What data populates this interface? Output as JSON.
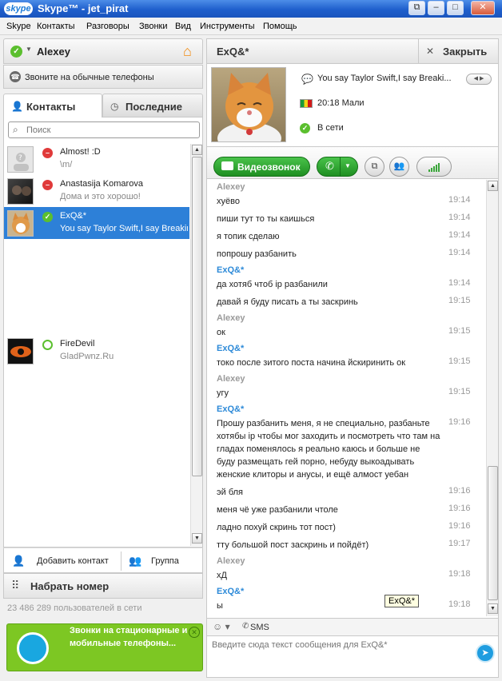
{
  "window": {
    "logo": "skype",
    "title": "Skype™ - jet_pirat",
    "buttons": [
      "⧉",
      "–",
      "□",
      "✕"
    ]
  },
  "menu": [
    "Skype",
    "Контакты",
    "Разговоры",
    "Звонки",
    "Вид",
    "Инструменты",
    "Помощь"
  ],
  "profile": {
    "name": "Alexey",
    "call_phones": "Звоните на обычные телефоны",
    "status_icon": "online-check-icon",
    "home_icon": "home-icon"
  },
  "tabs": {
    "contacts": "Контакты",
    "recent": "Последние"
  },
  "search": {
    "placeholder": "Поиск"
  },
  "contacts": [
    {
      "name": "Almost! :D",
      "mood": "\\m/",
      "status": "offline"
    },
    {
      "name": "Anastasija Komarova",
      "mood": "Дома и это хорошо!",
      "status": "offline"
    },
    {
      "name": "ExQ&*",
      "mood": "You say Taylor Swift,I say Breaking Benjamin.",
      "status": "online"
    },
    {
      "name": "FireDevil",
      "mood": "GladPwnz.Ru",
      "status": "away"
    }
  ],
  "left_bottom": {
    "add_contact": "Добавить контакт",
    "group": "Группа",
    "dial": "Набрать номер",
    "users_online": "23 486 289 пользователей в сети",
    "promo": "Звонки на стационарные и мобильные телефоны..."
  },
  "chat": {
    "name": "ExQ&*",
    "close": "Закрыть",
    "mood": "You say Taylor Swift,I say Breaki...",
    "local_time": "20:18 Мали",
    "status": "В сети",
    "video_call": "Видеозвонок",
    "tooltip": "ExQ&*",
    "sms": "SMS",
    "input_placeholder": "Введите сюда текст сообщения для ExQ&*"
  },
  "messages": [
    {
      "type": "sender",
      "who": "me",
      "text": "Alexey"
    },
    {
      "type": "msg",
      "text": "хуёво",
      "time": "19:14"
    },
    {
      "type": "msg",
      "text": "пиши тут то ты каишься",
      "time": "19:14"
    },
    {
      "type": "msg",
      "text": "я топик сделаю",
      "time": "19:14"
    },
    {
      "type": "msg",
      "text": "попрошу разбанить",
      "time": "19:14"
    },
    {
      "type": "sender",
      "who": "them",
      "text": "ExQ&*"
    },
    {
      "type": "msg",
      "text": "да хотяб чтоб ip разбанили",
      "time": "19:14"
    },
    {
      "type": "msg",
      "text": "давай я буду писать а ты заскринь",
      "time": "19:15"
    },
    {
      "type": "sender",
      "who": "me",
      "text": "Alexey"
    },
    {
      "type": "msg",
      "text": "ок",
      "time": "19:15"
    },
    {
      "type": "sender",
      "who": "them",
      "text": "ExQ&*"
    },
    {
      "type": "msg",
      "text": "токо после зитого поста начина йскиринить ок",
      "time": "19:15"
    },
    {
      "type": "sender",
      "who": "me",
      "text": "Alexey"
    },
    {
      "type": "msg",
      "text": "угу",
      "time": "19:15"
    },
    {
      "type": "sender",
      "who": "them",
      "text": "ExQ&*"
    },
    {
      "type": "msg",
      "text": "Прошу разбанить меня, я не специально, разбаньте хотябы ip чтобы мог заходить и посмотреть что там на гладах поменялось я реально каюсь и больше не буду размещать гей порно, небуду выкоадывать женские клиторы и анусы, и ещё алмост уебан",
      "time": "19:16",
      "lines": 5
    },
    {
      "type": "msg",
      "text": "эй бля",
      "time": "19:16"
    },
    {
      "type": "msg",
      "text": "меня чё уже разбанили чтоле",
      "time": "19:16"
    },
    {
      "type": "msg",
      "text": "ладно похуй скринь тот пост)",
      "time": "19:16"
    },
    {
      "type": "msg",
      "text": "тту большой пост заскринь и пойдёт)",
      "time": "19:17"
    },
    {
      "type": "sender",
      "who": "me",
      "text": "Alexey"
    },
    {
      "type": "msg",
      "text": "хД",
      "time": "19:18"
    },
    {
      "type": "sender",
      "who": "them",
      "text": "ExQ&*"
    },
    {
      "type": "msg",
      "text": "ы",
      "time": "19:18"
    }
  ],
  "colors": {
    "accent": "#2d80d8",
    "titlebar": "#1f5fcc",
    "online": "#5bbf2e",
    "offline": "#e03a3a",
    "call_green": "#1f8f22"
  }
}
